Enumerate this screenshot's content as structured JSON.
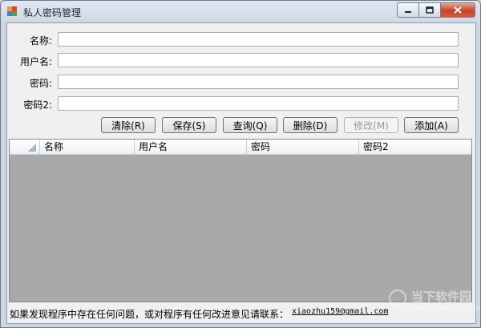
{
  "window": {
    "title": "私人密码管理",
    "minimize_icon": "minimize-icon",
    "maximize_icon": "maximize-icon",
    "close_icon": "close-icon"
  },
  "form": {
    "name_label": "名称:",
    "username_label": "用户名:",
    "password_label": "密码:",
    "password2_label": "密码2:",
    "name_value": "",
    "username_value": "",
    "password_value": "",
    "password2_value": ""
  },
  "buttons": {
    "clear": "清除(R)",
    "save": "保存(S)",
    "query": "查询(Q)",
    "delete": "删除(D)",
    "modify": "修改(M)",
    "add": "添加(A)"
  },
  "grid": {
    "columns": [
      "名称",
      "用户名",
      "密码",
      "密码2"
    ],
    "rows": []
  },
  "footer": {
    "text": "如果发现程序中存在任何问题，或对程序有任何改进意见请联系：",
    "email": "xiaozhu159@gmail.com"
  },
  "watermark": {
    "cn": "当下软件园",
    "en": "www.downxia.com"
  },
  "colors": {
    "titlebar": "#dfe7f1",
    "client": "#f0f0f0",
    "grid_background": "#a9a9a9",
    "close_button": "#c4442a"
  }
}
